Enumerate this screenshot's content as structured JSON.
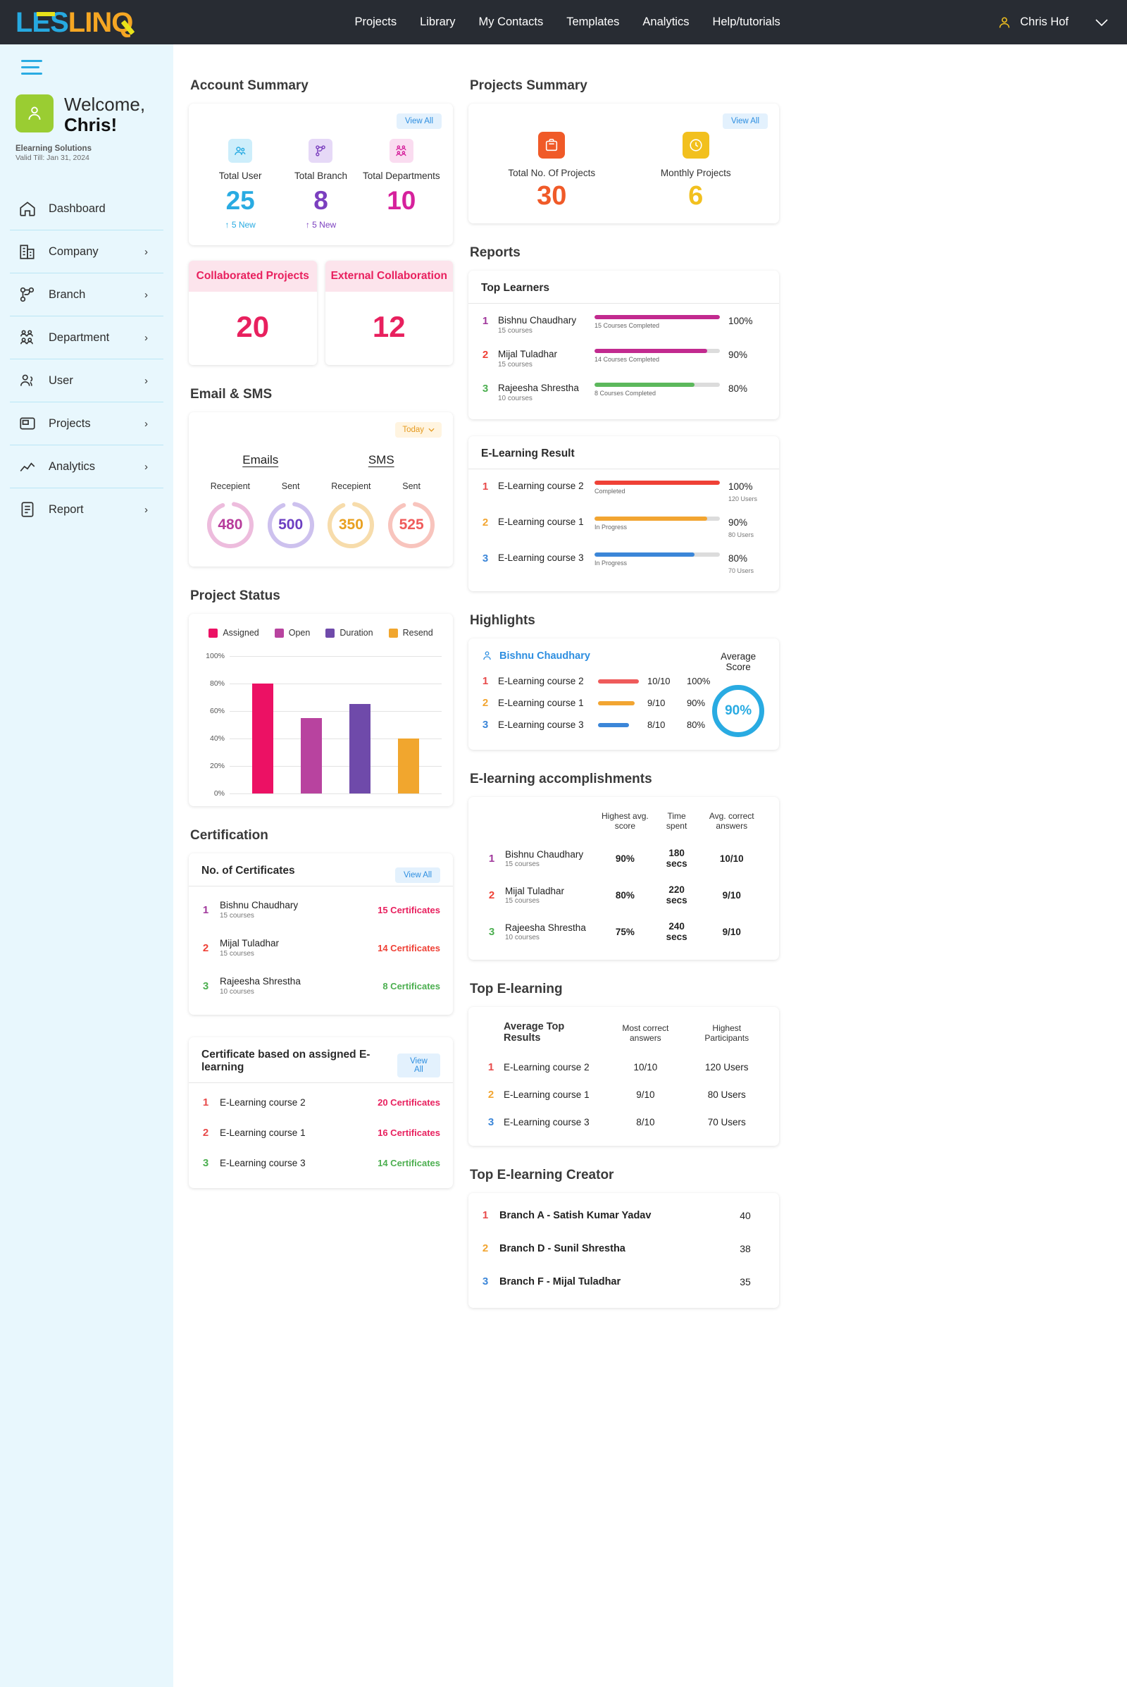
{
  "topbar": {
    "logo": {
      "part1": "LES",
      "part2": "LINQ"
    },
    "nav": [
      "Projects",
      "Library",
      "My Contacts",
      "Templates",
      "Analytics",
      "Help/tutorials"
    ],
    "user_name": "Chris Hof"
  },
  "sidebar": {
    "welcome_line1": "Welcome,",
    "welcome_line2": "Chris!",
    "plan": "Elearning Solutions",
    "valid": "Valid Till: Jan 31, 2024",
    "items": [
      {
        "label": "Dashboard",
        "icon": "home-icon",
        "chevron": false
      },
      {
        "label": "Company",
        "icon": "company-icon",
        "chevron": true
      },
      {
        "label": "Branch",
        "icon": "branch-icon",
        "chevron": true
      },
      {
        "label": "Department",
        "icon": "department-icon",
        "chevron": true
      },
      {
        "label": "User",
        "icon": "user-icon",
        "chevron": true
      },
      {
        "label": "Projects",
        "icon": "projects-icon",
        "chevron": true
      },
      {
        "label": "Analytics",
        "icon": "analytics-icon",
        "chevron": true
      },
      {
        "label": "Report",
        "icon": "report-icon",
        "chevron": true
      }
    ]
  },
  "account_summary": {
    "title": "Account Summary",
    "view_all": "View All",
    "stats": [
      {
        "label": "Total User",
        "value": "25",
        "new": "5 New",
        "color": "#29abe2",
        "bg": "#cdeefb",
        "icon": "users-icon"
      },
      {
        "label": "Total Branch",
        "value": "8",
        "new": "5 New",
        "color": "#7b3fbf",
        "bg": "#e6d9f7",
        "icon": "branch-icon"
      },
      {
        "label": "Total Departments",
        "value": "10",
        "new": "",
        "color": "#d6219c",
        "bg": "#fadcf0",
        "icon": "departments-icon"
      }
    ]
  },
  "collaboration": [
    {
      "title": "Collaborated Projects",
      "value": "20"
    },
    {
      "title": "External Collaboration",
      "value": "12"
    }
  ],
  "email_sms": {
    "title": "Email & SMS",
    "filter": "Today",
    "groups": [
      {
        "name": "Emails",
        "items": [
          {
            "label": "Recepient",
            "value": "480",
            "color": "#b73c9b",
            "track": "#edbcdd"
          },
          {
            "label": "Sent",
            "value": "500",
            "color": "#6c3fc2",
            "track": "#cdc1ee"
          }
        ]
      },
      {
        "name": "SMS",
        "items": [
          {
            "label": "Recepient",
            "value": "350",
            "color": "#e8a020",
            "track": "#f7dcab"
          },
          {
            "label": "Sent",
            "value": "525",
            "color": "#ef5b5b",
            "track": "#f8c4bd"
          }
        ]
      }
    ]
  },
  "project_status": {
    "title": "Project Status"
  },
  "chart_data": {
    "type": "bar",
    "title": "Project Status",
    "categories": [
      "Assigned",
      "Open",
      "Duration",
      "Resend"
    ],
    "values": [
      80,
      55,
      65,
      40
    ],
    "colors": [
      "#ec1164",
      "#b8439f",
      "#6f4aaa",
      "#f1a62e"
    ],
    "ylabel": "",
    "xlabel": "",
    "ylim": [
      0,
      100
    ],
    "yticks": [
      "100%",
      "80%",
      "60%",
      "40%",
      "20%",
      "0%"
    ],
    "grid": true,
    "legend": [
      "Assigned",
      "Open",
      "Duration",
      "Resend"
    ],
    "legend_position": "top"
  },
  "projects_summary": {
    "title": "Projects Summary",
    "view_all": "View All",
    "items": [
      {
        "label": "Total No. Of Projects",
        "value": "30",
        "color": "#f05a28",
        "bg": "#fde3d8",
        "icon": "briefcase-icon"
      },
      {
        "label": "Monthly Projects",
        "value": "6",
        "color": "#f2c01e",
        "bg": "#fdf2cd",
        "icon": "target-icon"
      }
    ]
  },
  "reports": {
    "title": "Reports",
    "top_learners": {
      "title": "Top Learners",
      "rows": [
        {
          "rank": "1",
          "name": "Bishnu Chaudhary",
          "courses": "15 courses",
          "pct": "100%",
          "fill": 100,
          "color": "#c22a8f",
          "caption": "15 Courses Completed"
        },
        {
          "rank": "2",
          "name": "Mijal Tuladhar",
          "courses": "15 courses",
          "pct": "90%",
          "fill": 90,
          "color": "#c22a8f",
          "caption": "14 Courses Completed"
        },
        {
          "rank": "3",
          "name": "Rajeesha Shrestha",
          "courses": "10 courses",
          "pct": "80%",
          "fill": 80,
          "color": "#5cb85c",
          "caption": "8 Courses Completed"
        }
      ]
    },
    "elearning_result": {
      "title": "E-Learning Result",
      "rows": [
        {
          "rank": "1",
          "name": "E-Learning course 2",
          "pct": "100%",
          "fill": 100,
          "color": "#ef4136",
          "caption": "Completed",
          "users": "120 Users"
        },
        {
          "rank": "2",
          "name": "E-Learning course 1",
          "pct": "90%",
          "fill": 90,
          "color": "#f2a531",
          "caption": "In Progress",
          "users": "80 Users"
        },
        {
          "rank": "3",
          "name": "E-Learning course 3",
          "pct": "80%",
          "fill": 80,
          "color": "#3b86d8",
          "caption": "In Progress",
          "users": "70 Users"
        }
      ]
    }
  },
  "highlights": {
    "title": "Highlights",
    "person": "Bishnu Chaudhary",
    "avg_label": "Average Score",
    "avg_value": "90%",
    "rows": [
      {
        "rank": "1",
        "name": "E-Learning course 2",
        "score": "10/10",
        "pct": "100%",
        "fill": 100,
        "color": "#ef5b5b"
      },
      {
        "rank": "2",
        "name": "E-Learning course 1",
        "score": "9/10",
        "pct": "90%",
        "fill": 88,
        "color": "#f2a531"
      },
      {
        "rank": "3",
        "name": "E-Learning course 3",
        "score": "8/10",
        "pct": "80%",
        "fill": 74,
        "color": "#3b86d8"
      }
    ]
  },
  "accomplishments": {
    "title": "E-learning accomplishments",
    "headers": [
      "Highest avg. score",
      "Time spent",
      "Avg. correct answers"
    ],
    "rows": [
      {
        "rank": "1",
        "name": "Bishnu Chaudhary",
        "courses": "15 courses",
        "score": "90%",
        "time": "180 secs",
        "answers": "10/10",
        "style": "pinkv"
      },
      {
        "rank": "2",
        "name": "Mijal Tuladhar",
        "courses": "15 courses",
        "score": "80%",
        "time": "220 secs",
        "answers": "9/10",
        "style": "redv"
      },
      {
        "rank": "3",
        "name": "Rajeesha Shrestha",
        "courses": "10 courses",
        "score": "75%",
        "time": "240 secs",
        "answers": "9/10",
        "style": "greenv"
      }
    ]
  },
  "top_elearning": {
    "title": "Top E-learning",
    "headers": [
      "Average Top Results",
      "Most correct answers",
      "Highest Participants"
    ],
    "rows": [
      {
        "rank": "1",
        "name": "E-Learning course 2",
        "correct": "10/10",
        "participants": "120 Users"
      },
      {
        "rank": "2",
        "name": "E-Learning course 1",
        "correct": "9/10",
        "participants": "80 Users"
      },
      {
        "rank": "3",
        "name": "E-Learning course 3",
        "correct": "8/10",
        "participants": "70 Users"
      }
    ]
  },
  "top_creator": {
    "title": "Top E-learning Creator",
    "rows": [
      {
        "rank": "1",
        "name": "Branch A - Satish Kumar Yadav",
        "value": "40"
      },
      {
        "rank": "2",
        "name": "Branch D - Sunil Shrestha",
        "value": "38"
      },
      {
        "rank": "3",
        "name": "Branch F - Mijal Tuladhar",
        "value": "35"
      }
    ]
  },
  "certification": {
    "title": "Certification",
    "certificates": {
      "title": "No. of Certificates",
      "view_all": "View All",
      "rows": [
        {
          "rank": "1",
          "name": "Bishnu Chaudhary",
          "courses": "15 courses",
          "value": "15 Certificates",
          "style": "pinkv"
        },
        {
          "rank": "2",
          "name": "Mijal Tuladhar",
          "courses": "15 courses",
          "value": "14 Certificates",
          "style": "redv"
        },
        {
          "rank": "3",
          "name": "Rajeesha Shrestha",
          "courses": "10 courses",
          "value": "8 Certificates",
          "style": "greenv"
        }
      ]
    },
    "assigned": {
      "title": "Certificate based on assigned E-learning",
      "view_all": "View All",
      "rows": [
        {
          "rank": "1",
          "name": "E-Learning course 2",
          "value": "20 Certificates",
          "style": "pinkv"
        },
        {
          "rank": "2",
          "name": "E-Learning course 1",
          "value": "16 Certificates",
          "style": "redv"
        },
        {
          "rank": "3",
          "name": "E-Learning course 3",
          "value": "14 Certificates",
          "style": "greenv"
        }
      ]
    }
  }
}
